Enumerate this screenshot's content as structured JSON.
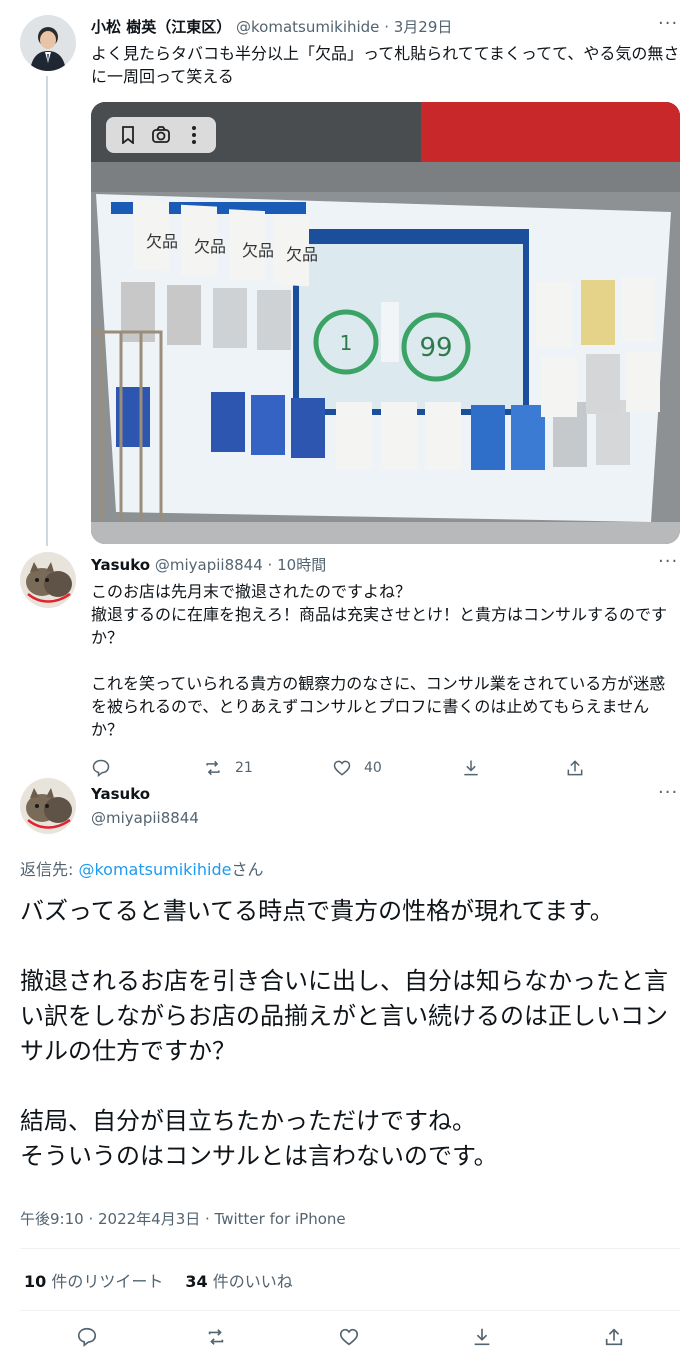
{
  "original_tweet": {
    "display_name": "小松 樹英（江東区）",
    "handle": "@komatsumikihide",
    "date": "3月29日",
    "text": "よく見たらタバコも半分以上「欠品」って札貼られててまくってて、やる気の無さに一周回って笑える",
    "more_icon": "more-horizontal-icon",
    "media_icons": [
      "bookmark-icon",
      "camera-lens-icon",
      "more-vertical-icon"
    ],
    "photo_sign_text": "欠品"
  },
  "reply_tweet": {
    "display_name": "Yasuko",
    "handle": "@miyapii8844",
    "time": "10時間",
    "text": "このお店は先月末で撤退されたのですよね？\n撤退するのに在庫を抱えろ！商品は充実させとけ！と貴方はコンサルするのですか？\n\nこれを笑っていられる貴方の観察力のなさに、コンサル業をされている方が迷惑を被られるので、とりあえずコンサルとプロフに書くのは止めてもらえませんか？",
    "actions": {
      "retweets": "21",
      "likes": "40"
    }
  },
  "main_tweet": {
    "display_name": "Yasuko",
    "handle": "@miyapii8844",
    "reply_prefix": "返信先: ",
    "reply_to_handle": "@komatsumikihide",
    "reply_suffix": "さん",
    "text": "バズってると書いてる時点で貴方の性格が現れてます。\n\n撤退されるお店を引き合いに出し、自分は知らなかったと言い訳をしながらお店の品揃えがと言い続けるのは正しいコンサルの仕方ですか？\n\n結局、自分が目立ちたかっただけですね。\nそういうのはコンサルとは言わないのです。",
    "timestamp": "午後9:10 · 2022年4月3日 · Twitter for iPhone",
    "retweet_count": "10",
    "retweet_label": " 件のリツイート",
    "like_count": "34",
    "like_label": " 件のいいね"
  },
  "colors": {
    "accent": "#1d9bf0",
    "text": "#0f1419",
    "muted": "#536471",
    "divider": "#eff3f4",
    "thread_line": "#cfd9de"
  }
}
